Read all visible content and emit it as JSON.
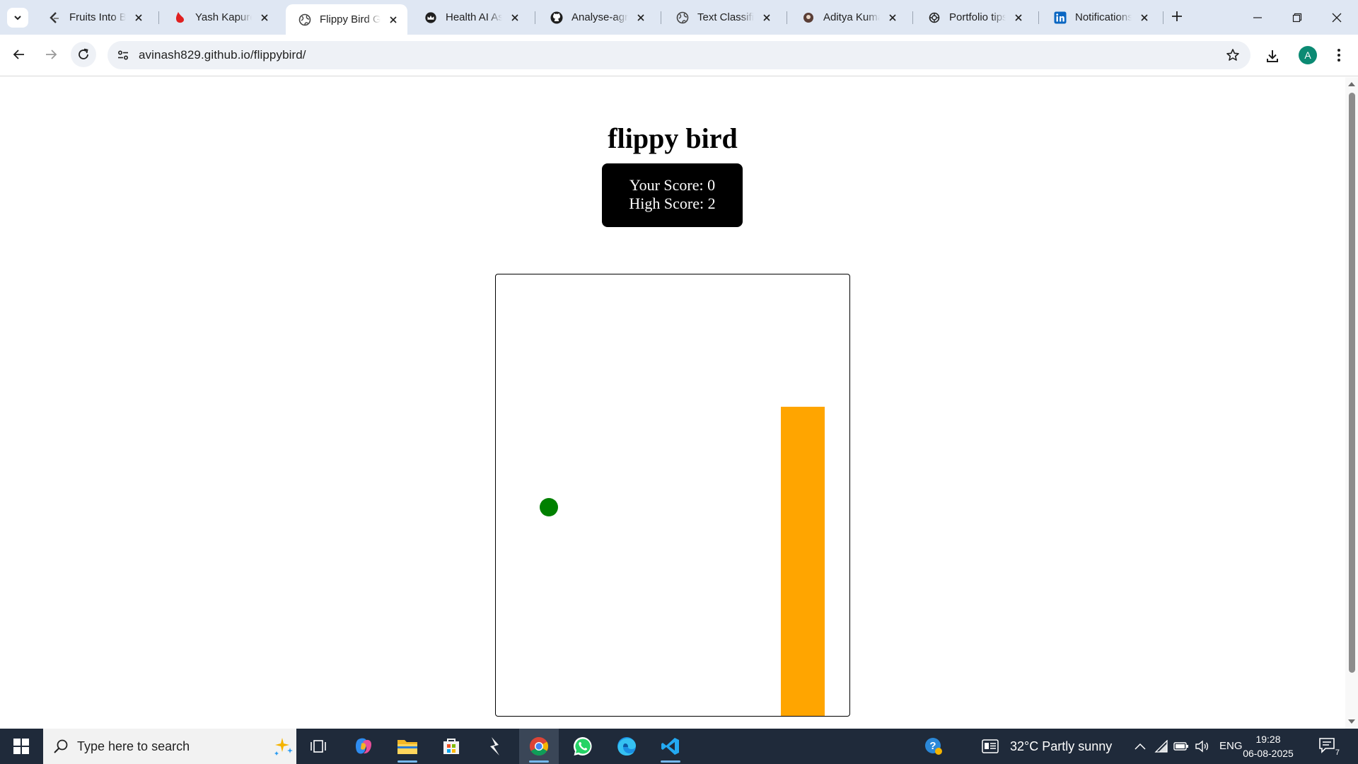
{
  "browser": {
    "tabs": [
      {
        "title": "Fruits Into Baskets",
        "favicon": "leetcode-icon",
        "active": false
      },
      {
        "title": "Yash Kapure | LinkedIn",
        "favicon": "droplet-icon",
        "active": false
      },
      {
        "title": "Flippy Bird Game",
        "favicon": "globe-icon",
        "active": true
      },
      {
        "title": "Health AI Assistant",
        "favicon": "crown-icon",
        "active": false
      },
      {
        "title": "Analyse-agriculture",
        "favicon": "github-icon",
        "active": false
      },
      {
        "title": "Text Classification",
        "favicon": "globe-icon",
        "active": false
      },
      {
        "title": "Aditya Kumar",
        "favicon": "kaggle-icon",
        "active": false
      },
      {
        "title": "Portfolio tips",
        "favicon": "chatgpt-icon",
        "active": false
      },
      {
        "title": "Notifications",
        "favicon": "linkedin-icon",
        "active": false
      }
    ],
    "url": "avinash829.github.io/flippybird/",
    "profile_initial": "A"
  },
  "page": {
    "title": "flippy bird",
    "score_label": "Your Score: 0",
    "high_score_label": "High Score: 2",
    "score": 0,
    "high_score": 2
  },
  "game": {
    "bird_color": "#008000",
    "pipe_color": "#ffa500"
  },
  "taskbar": {
    "search_placeholder": "Type here to search",
    "weather": "32°C  Partly sunny",
    "language": "ENG",
    "time": "19:28",
    "date": "06-08-2025",
    "notification_count": "7"
  }
}
